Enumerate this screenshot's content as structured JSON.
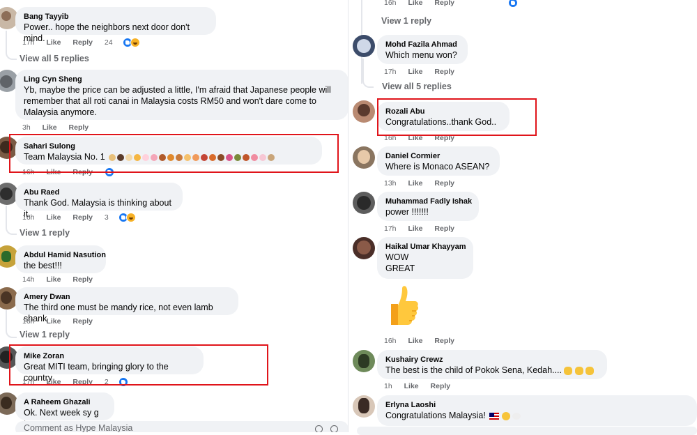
{
  "labels": {
    "like": "Like",
    "reply": "Reply"
  },
  "left": {
    "comments": [
      {
        "author": "Bang Tayyib",
        "text": "Power.. hope the neighbors next door don't mind.",
        "time": "17h",
        "reactions": "24",
        "view_replies": "View all 5 replies"
      },
      {
        "author": "Ling Cyn Sheng",
        "text": "Yb, maybe the price can be adjusted a little, I'm afraid that Japanese people will remember that all roti canai in Malaysia costs RM50 and won't dare come to Malaysia anymore.",
        "time": "3h"
      },
      {
        "author": "Sahari Sulong",
        "text": "Team Malaysia No. 1",
        "time": "16h"
      },
      {
        "author": "Abu Raed",
        "text": "Thank God. Malaysia is thinking about it.",
        "time": "16h",
        "reactions": "3",
        "view_replies": "View 1 reply"
      },
      {
        "author": "Abdul Hamid Nasution",
        "text": "the best!!!",
        "time": "14h"
      },
      {
        "author": "Amery Dwan",
        "text": "The third one must be mandy rice, not even lamb shank",
        "time": "16h",
        "view_replies": "View 1 reply"
      },
      {
        "author": "Mike Zoran",
        "text": "Great MITI team, bringing glory to the country",
        "time": "17h",
        "reactions": "2"
      },
      {
        "author": "A Raheem Ghazali",
        "text": "Ok. Next week sy g try"
      }
    ],
    "composer_placeholder": "Comment as Hype Malaysia"
  },
  "right": {
    "top_time": "16h",
    "top_view_replies": "View 1 reply",
    "comments": [
      {
        "author": "Mohd Fazila Ahmad",
        "text": "Which menu won?",
        "time": "17h",
        "view_replies": "View all 5 replies"
      },
      {
        "author": "Rozali Abu",
        "text": "Congratulations..thank God..",
        "time": "16h"
      },
      {
        "author": "Daniel Cormier",
        "text": "Where is Monaco ASEAN?",
        "time": "13h"
      },
      {
        "author": "Muhammad Fadly Ishak",
        "text": "power !!!!!!!",
        "time": "17h"
      },
      {
        "author": "Haikal Umar Khayyam",
        "text_line1": "WOW",
        "text_line2": "GREAT",
        "time": "16h"
      },
      {
        "author": "Kushairy Crewz",
        "text": "The best is the child of Pokok Sena, Kedah....",
        "time": "1h"
      },
      {
        "author": "Erlyna Laoshi",
        "text": "Congratulations Malaysia!"
      }
    ]
  },
  "colors": {
    "highlight": "#e0141a",
    "bubble": "#f0f2f5",
    "meta": "#65676b",
    "like_blue": "#1877f2"
  },
  "icons": [
    "like-reaction-icon",
    "haha-reaction-icon",
    "thumbs-up-emoji",
    "malaysia-flag-emoji",
    "clap-emoji",
    "emoji-icon"
  ]
}
